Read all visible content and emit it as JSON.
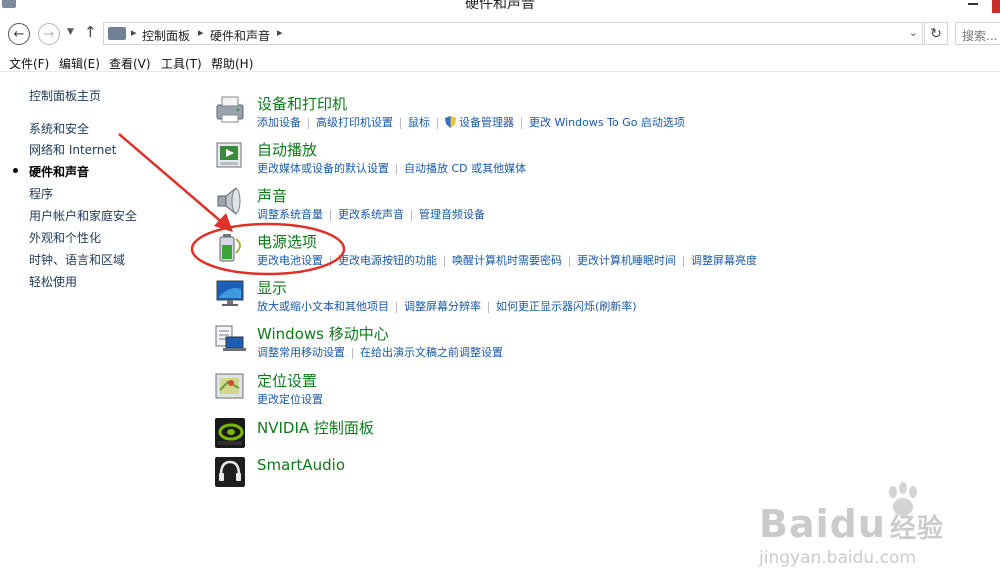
{
  "window": {
    "title": "硬件和声音"
  },
  "address": {
    "crumbs": [
      "控制面板",
      "硬件和声音"
    ],
    "search_placeholder": "搜索..."
  },
  "menu": [
    "文件(F)",
    "编辑(E)",
    "查看(V)",
    "工具(T)",
    "帮助(H)"
  ],
  "sidebar": {
    "home": "控制面板主页",
    "items": [
      "系统和安全",
      "网络和 Internet",
      "硬件和声音",
      "程序",
      "用户帐户和家庭安全",
      "外观和个性化",
      "时钟、语言和区域",
      "轻松使用"
    ],
    "current_index": 2
  },
  "categories": [
    {
      "title": "设备和打印机",
      "icon": "devices-printers-icon",
      "links": [
        "添加设备",
        "高级打印机设置",
        "鼠标",
        "设备管理器",
        "更改 Windows To Go 启动选项"
      ]
    },
    {
      "title": "自动播放",
      "icon": "autoplay-icon",
      "links": [
        "更改媒体或设备的默认设置",
        "自动播放 CD 或其他媒体"
      ]
    },
    {
      "title": "声音",
      "icon": "speaker-icon",
      "links": [
        "调整系统音量",
        "更改系统声音",
        "管理音频设备"
      ]
    },
    {
      "title": "电源选项",
      "icon": "battery-icon",
      "links": [
        "更改电池设置",
        "更改电源按钮的功能",
        "唤醒计算机时需要密码",
        "更改计算机睡眠时间",
        "调整屏幕亮度"
      ]
    },
    {
      "title": "显示",
      "icon": "display-icon",
      "links": [
        "放大或缩小文本和其他项目",
        "调整屏幕分辨率",
        "如何更正显示器闪烁(刷新率)"
      ]
    },
    {
      "title": "Windows 移动中心",
      "icon": "mobility-center-icon",
      "links": [
        "调整常用移动设置",
        "在给出演示文稿之前调整设置"
      ]
    },
    {
      "title": "定位设置",
      "icon": "location-icon",
      "links": [
        "更改定位设置"
      ]
    },
    {
      "title": "NVIDIA 控制面板",
      "icon": "nvidia-icon",
      "links": []
    },
    {
      "title": "SmartAudio",
      "icon": "headphones-icon",
      "links": []
    }
  ],
  "watermark": {
    "brand": "Bai",
    "brand2": "du",
    "brand_cn": "经验",
    "url": "jingyan.baidu.com"
  },
  "colors": {
    "heading": "#0f7a1a",
    "link": "#1a5aa8",
    "annotation": "#e0302a"
  }
}
